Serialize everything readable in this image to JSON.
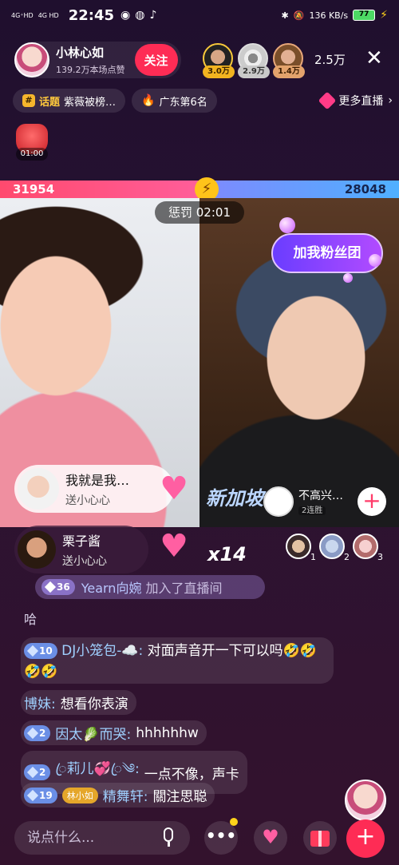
{
  "status_bar": {
    "network_left": "4G⁺HD",
    "network_right": "4G HD",
    "time": "22:45",
    "speed": "136 KB/s",
    "battery": "77"
  },
  "host": {
    "name": "小林心如",
    "likes": "139.2万本场点赞",
    "follow_label": "关注"
  },
  "top_viewers": [
    {
      "count": "3.0万"
    },
    {
      "count": "2.9万"
    },
    {
      "count": "1.4万"
    }
  ],
  "viewer_total": "2.5万",
  "tags": {
    "topic_label": "话题",
    "topic_text": "紫薇被榜…",
    "rank_text": "广东第6名",
    "more_live": "更多直播"
  },
  "packet_timer": "01:00",
  "pk": {
    "left_score": "31954",
    "right_score": "28048",
    "left_fraction": 0.532
  },
  "penalty": "惩罚 02:01",
  "fan_sign": "加我粉丝团",
  "gift_events": [
    {
      "name": "我就是我…",
      "sub": "送小心心"
    },
    {
      "name": "栗子酱",
      "sub": "送小心心",
      "combo": "x14"
    }
  ],
  "anime_user": {
    "name": "不高兴…",
    "streak": "2连胜"
  },
  "stickers": "新加坡",
  "top_rank": [
    "1",
    "2",
    "3"
  ],
  "join": {
    "level": "36",
    "user": "Yearn向婉",
    "action": "加入了直播间"
  },
  "chat": {
    "plain": "哈",
    "msg1": {
      "level": "10",
      "user": "DJ小笼包-☁️:",
      "text": "对面声音开一下可以吗🤣🤣🤣🤣"
    },
    "msg2": {
      "user": "博妹:",
      "text": "想看你表演"
    },
    "msg3": {
      "level": "2",
      "user": "因太🥬而哭:",
      "text": "hhhhhhw"
    },
    "msg4": {
      "level": "2",
      "user": "ꦿ莉儿💞ꦿ༄:",
      "text": "一点不像，声卡"
    },
    "msg5": {
      "level": "19",
      "fan_badge": "林小如",
      "user": "精舞轩:",
      "text": "關注思聪"
    }
  },
  "bottom": {
    "input_placeholder": "说点什么...",
    "more_label": "•••",
    "plus_label": "+"
  }
}
